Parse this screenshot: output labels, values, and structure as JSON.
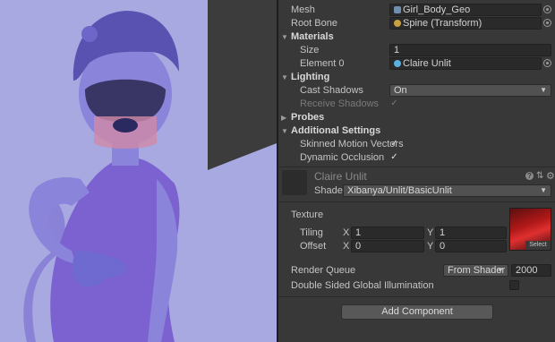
{
  "inspector": {
    "mesh": {
      "label": "Mesh",
      "value": "Girl_Body_Geo",
      "icon": "mesh-icon"
    },
    "root_bone": {
      "label": "Root Bone",
      "value": "Spine (Transform)",
      "icon": "transform-icon"
    },
    "materials": {
      "header": "Materials",
      "size_label": "Size",
      "size_value": "1",
      "element_label": "Element 0",
      "element_value": "Claire Unlit"
    },
    "lighting": {
      "header": "Lighting",
      "cast_label": "Cast Shadows",
      "cast_value": "On",
      "receive_label": "Receive Shadows",
      "receive_checked": true
    },
    "probes": {
      "header": "Probes"
    },
    "additional": {
      "header": "Additional Settings",
      "motion_label": "Skinned Motion Vectors",
      "motion_checked": true,
      "occlusion_label": "Dynamic Occlusion",
      "occlusion_checked": true
    }
  },
  "material": {
    "name": "Claire Unlit",
    "shader_label": "Shader",
    "shader_value": "Xibanya/Unlit/BasicUnlit",
    "texture_label": "Texture",
    "tiling_label": "Tiling",
    "offset_label": "Offset",
    "x_label": "X",
    "y_label": "Y",
    "tiling_x": "1",
    "tiling_y": "1",
    "offset_x": "0",
    "offset_y": "0",
    "select_label": "Select",
    "render_queue_label": "Render Queue",
    "render_queue_mode": "From Shader",
    "render_queue_value": "2000",
    "double_sided_label": "Double Sided Global Illumination",
    "double_sided_checked": false
  },
  "add_component_label": "Add Component",
  "glyphs": {
    "check": "✓",
    "caret": "▼",
    "arrow_open": "▼",
    "arrow_closed": "▶"
  },
  "colors": {
    "scene_background": "#a8a8e0",
    "character_tint": "#7f78d0",
    "dress": "#7b5fcf",
    "panel": "#383838"
  }
}
